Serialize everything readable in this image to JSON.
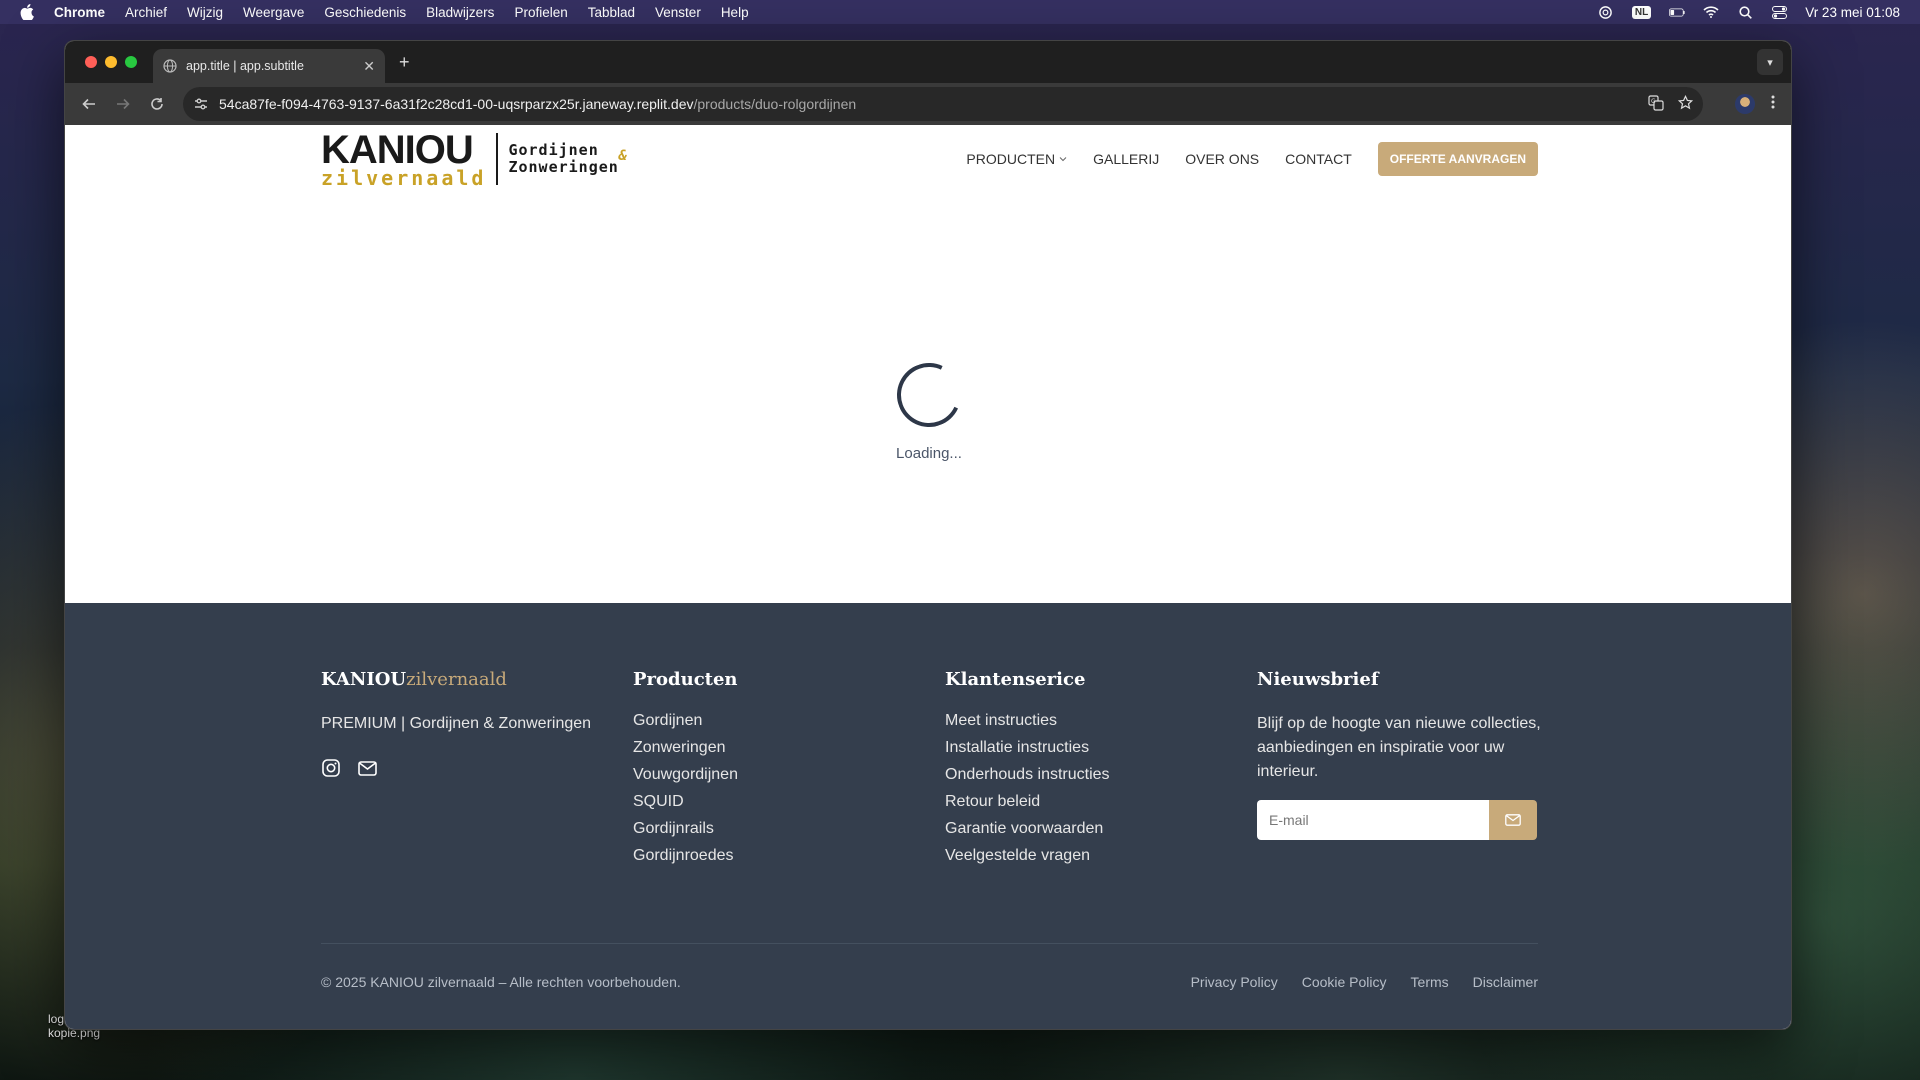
{
  "menubar": {
    "app": "Chrome",
    "items": [
      "Archief",
      "Wijzig",
      "Weergave",
      "Geschiedenis",
      "Bladwijzers",
      "Profielen",
      "Tabblad",
      "Venster",
      "Help"
    ],
    "lang_badge": "NL",
    "clock": "Vr 23 mei  01:08"
  },
  "desktop": {
    "file_label_1": "log",
    "file_label_2": "kopie.png"
  },
  "browser": {
    "tab_title": "app.title | app.subtitle",
    "url_host": "54ca87fe-f094-4763-9137-6a31f2c28cd1-00-uqsrparzx25r.janeway.replit.dev",
    "url_path": "/products/duo-rolgordijnen"
  },
  "site": {
    "logo": {
      "brand": "KANIOU",
      "sub": "zilvernaald",
      "line1": "Gordijnen",
      "amp": "&",
      "line2": "Zonweringen"
    },
    "nav": {
      "products": "PRODUCTEN",
      "gallery": "GALLERIJ",
      "about": "OVER ONS",
      "contact": "CONTACT",
      "cta": "OFFERTE AANVRAGEN"
    },
    "loading": "Loading...",
    "footer": {
      "brand_a": "KANIOU",
      "brand_b": "zilvernaald",
      "tagline": "PREMIUM | Gordijnen & Zonweringen",
      "products_title": "Producten",
      "products": [
        "Gordijnen",
        "Zonweringen",
        "Vouwgordijnen",
        "SQUID",
        "Gordijnrails",
        "Gordijnroedes"
      ],
      "service_title": "Klantenserice",
      "service": [
        "Meet instructies",
        "Installatie instructies",
        "Onderhouds instructies",
        "Retour beleid",
        "Garantie voorwaarden",
        "Veelgestelde vragen"
      ],
      "newsletter_title": "Nieuwsbrief",
      "newsletter_text": "Blijf op de hoogte van nieuwe collecties, aanbiedingen en inspiratie voor uw interieur.",
      "email_placeholder": "E-mail",
      "copyright": "© 2025 KANIOU zilvernaald – Alle rechten voorbehouden.",
      "legal": [
        "Privacy Policy",
        "Cookie Policy",
        "Terms",
        "Disclaimer"
      ]
    }
  },
  "colors": {
    "gold": "#c8aa7a",
    "footer_bg": "#343e4d",
    "logo_gold": "#c9a227"
  }
}
